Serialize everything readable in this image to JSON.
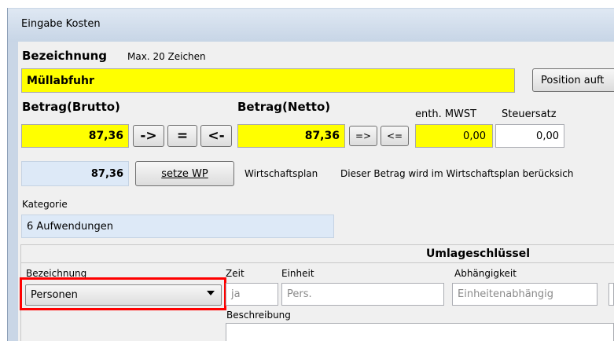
{
  "window": {
    "title": "Eingabe Kosten"
  },
  "bezeichnung": {
    "label": "Bezeichnung",
    "hint": "Max. 20 Zeichen",
    "value": "Müllabfuhr",
    "position_button": "Position auft"
  },
  "betrag": {
    "brutto_label": "Betrag(Brutto)",
    "netto_label": "Betrag(Netto)",
    "mwst_label": "enth. MWST",
    "steuersatz_label": "Steuersatz",
    "brutto_value": "87,36",
    "netto_value": "87,36",
    "mwst_value": "0,00",
    "steuersatz_value": "0,00",
    "btn_to_right": "->",
    "btn_equal": "=",
    "btn_to_left": "<-",
    "btn_netto_right": "=>",
    "btn_netto_left": "<="
  },
  "wirtschaftsplan": {
    "value": "87,36",
    "button": "setze WP",
    "label": "Wirtschaftsplan",
    "note": "Dieser Betrag wird im Wirtschaftsplan berücksich"
  },
  "kategorie": {
    "label": "Kategorie",
    "value": "6 Aufwendungen"
  },
  "umlage": {
    "header": "Umlageschlüssel",
    "col_bezeichnung": "Bezeichnung",
    "col_zeit": "Zeit",
    "col_einheit": "Einheit",
    "col_abhaengigkeit": "Abhängigkeit",
    "selected": "Personen",
    "zeit_value": "ja",
    "einheit_value": "Pers.",
    "abhaengigkeit_value": "Einheitenabhängig",
    "beschreibung_label": "Beschreibung"
  },
  "colors": {
    "highlight": "#ff0000",
    "input_yellow": "#ffff00",
    "field_blue": "#dde9f7"
  }
}
